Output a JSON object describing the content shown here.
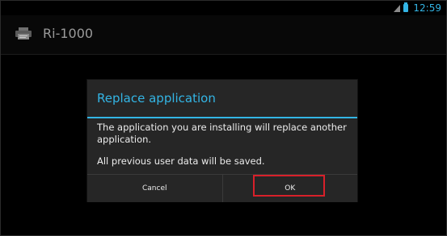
{
  "status_bar": {
    "time": "12:59",
    "signal_icon": "signal-icon",
    "battery_icon": "battery-icon",
    "accent_color": "#33b5e5"
  },
  "app_header": {
    "title": "Ri-1000",
    "icon": "printer-icon"
  },
  "dialog": {
    "title": "Replace application",
    "message_line_1": "The application you are installing will replace another application.",
    "message_line_2": "All previous user data will be saved.",
    "buttons": {
      "cancel_label": "Cancel",
      "ok_label": "OK"
    },
    "title_color": "#33b5e5",
    "highlight_color": "#d8202a"
  }
}
